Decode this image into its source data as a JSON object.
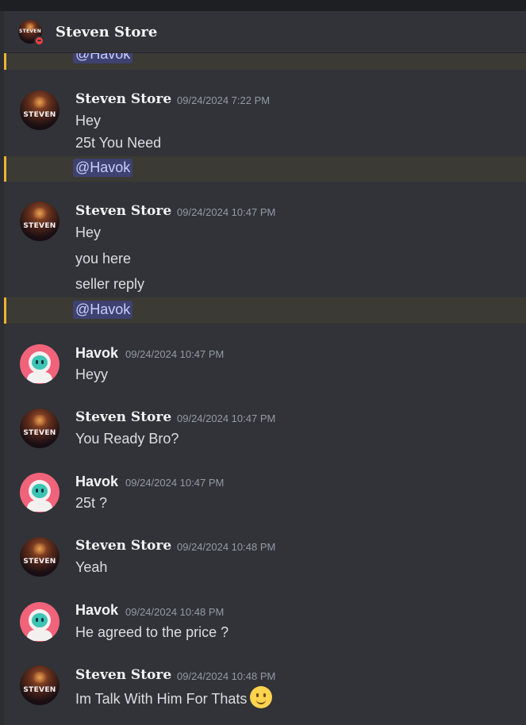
{
  "channel": {
    "title": "Steven Store",
    "status": "dnd"
  },
  "clipped_mention": "@Havok",
  "messages": [
    {
      "author": "Steven Store",
      "timestamp": "09/24/2024 7:22 PM",
      "lines": [
        "Hey",
        "25t You Need"
      ],
      "mention": "@Havok"
    },
    {
      "author": "Steven Store",
      "timestamp": "09/24/2024 10:47 PM",
      "lines": [
        "Hey",
        "you here",
        "seller reply"
      ],
      "mention": "@Havok"
    },
    {
      "author": "Havok",
      "timestamp": "09/24/2024 10:47 PM",
      "lines": [
        "Heyy"
      ]
    },
    {
      "author": "Steven Store",
      "timestamp": "09/24/2024 10:47 PM",
      "lines": [
        "You Ready Bro?"
      ]
    },
    {
      "author": "Havok",
      "timestamp": "09/24/2024 10:47 PM",
      "lines": [
        "25t ?"
      ]
    },
    {
      "author": "Steven Store",
      "timestamp": "09/24/2024 10:48 PM",
      "lines": [
        "Yeah"
      ]
    },
    {
      "author": "Havok",
      "timestamp": "09/24/2024 10:48 PM",
      "lines": [
        "He agreed to the price ?"
      ]
    },
    {
      "author": "Steven Store",
      "timestamp": "09/24/2024 10:48 PM",
      "lines": [
        "Im Talk With Him For Thats"
      ],
      "emoji": "slightly-smiling-face"
    }
  ],
  "avatar_label": "STEVEN",
  "colors": {
    "background": "#313338",
    "mention_highlight": "#3b3a34",
    "mention_bar": "#f0b232",
    "mention_pill": "#3e4270",
    "dnd": "#f23f43"
  }
}
